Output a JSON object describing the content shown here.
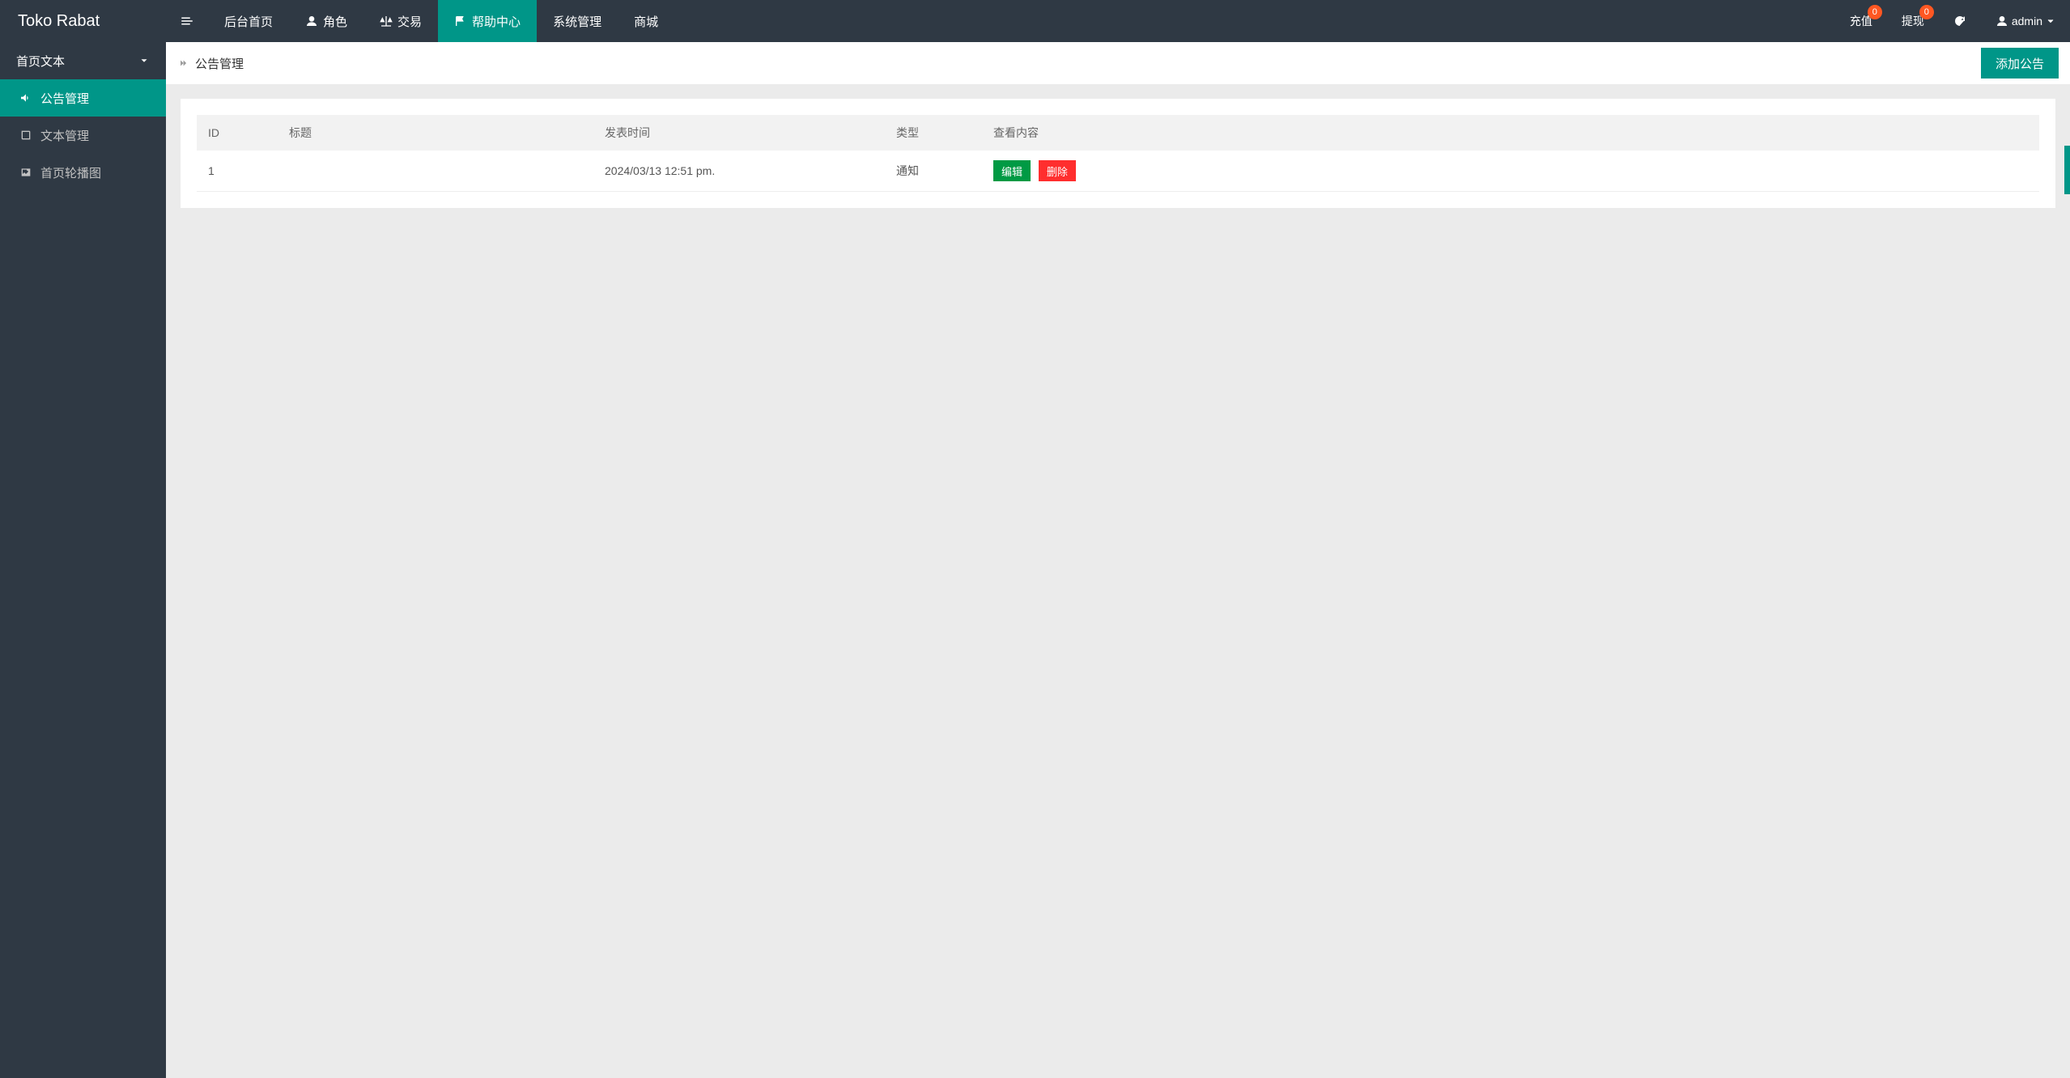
{
  "brand": "Toko Rabat",
  "topnav": {
    "items": [
      {
        "label": "后台首页",
        "icon": null
      },
      {
        "label": "角色",
        "icon": "user"
      },
      {
        "label": "交易",
        "icon": "scale"
      },
      {
        "label": "帮助中心",
        "icon": "flag",
        "active": true
      },
      {
        "label": "系统管理",
        "icon": null
      },
      {
        "label": "商城",
        "icon": null
      }
    ]
  },
  "topright": {
    "recharge": {
      "label": "充值",
      "badge": "0"
    },
    "withdraw": {
      "label": "提现",
      "badge": "0"
    },
    "user": {
      "label": "admin"
    }
  },
  "sidebar": {
    "group_label": "首页文本",
    "items": [
      {
        "label": "公告管理",
        "icon": "announce",
        "active": true
      },
      {
        "label": "文本管理",
        "icon": "book"
      },
      {
        "label": "首页轮播图",
        "icon": "image"
      }
    ]
  },
  "breadcrumb": {
    "title": "公告管理"
  },
  "actions": {
    "add_label": "添加公告"
  },
  "table": {
    "headers": {
      "id": "ID",
      "title": "标题",
      "time": "发表时间",
      "type": "类型",
      "actions": "查看内容"
    },
    "row_actions": {
      "edit": "编辑",
      "delete": "删除"
    },
    "rows": [
      {
        "id": "1",
        "title": "",
        "time": "2024/03/13 12:51 pm.",
        "type": "通知"
      }
    ]
  }
}
